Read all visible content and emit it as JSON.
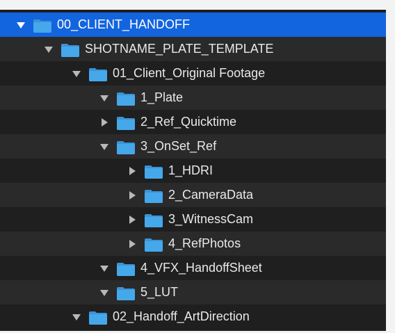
{
  "window": {
    "background": "#1f1f1f",
    "row_alt": "#2a2a2a",
    "selection": "#1364df",
    "text": "#e9e9e9",
    "folder_blue": "#45a8eb",
    "disclosure_gray": "#b8b8b8"
  },
  "rows": [
    {
      "label": "00_CLIENT_HANDOFF",
      "depth": 0,
      "expanded": true,
      "selected": true,
      "icon": "folder-icon"
    },
    {
      "label": "SHOTNAME_PLATE_TEMPLATE",
      "depth": 1,
      "expanded": true,
      "selected": false,
      "icon": "folder-icon"
    },
    {
      "label": "01_Client_Original Footage",
      "depth": 2,
      "expanded": true,
      "selected": false,
      "icon": "folder-icon"
    },
    {
      "label": "1_Plate",
      "depth": 3,
      "expanded": true,
      "selected": false,
      "icon": "folder-icon"
    },
    {
      "label": "2_Ref_Quicktime",
      "depth": 3,
      "expanded": false,
      "selected": false,
      "icon": "folder-icon"
    },
    {
      "label": "3_OnSet_Ref",
      "depth": 3,
      "expanded": true,
      "selected": false,
      "icon": "folder-icon"
    },
    {
      "label": "1_HDRI",
      "depth": 4,
      "expanded": false,
      "selected": false,
      "icon": "folder-icon"
    },
    {
      "label": "2_CameraData",
      "depth": 4,
      "expanded": false,
      "selected": false,
      "icon": "folder-icon"
    },
    {
      "label": "3_WitnessCam",
      "depth": 4,
      "expanded": false,
      "selected": false,
      "icon": "folder-icon"
    },
    {
      "label": "4_RefPhotos",
      "depth": 4,
      "expanded": false,
      "selected": false,
      "icon": "folder-icon"
    },
    {
      "label": "4_VFX_HandoffSheet",
      "depth": 3,
      "expanded": true,
      "selected": false,
      "icon": "folder-icon"
    },
    {
      "label": "5_LUT",
      "depth": 3,
      "expanded": true,
      "selected": false,
      "icon": "folder-icon"
    },
    {
      "label": "02_Handoff_ArtDirection",
      "depth": 2,
      "expanded": true,
      "selected": false,
      "icon": "folder-icon"
    }
  ]
}
